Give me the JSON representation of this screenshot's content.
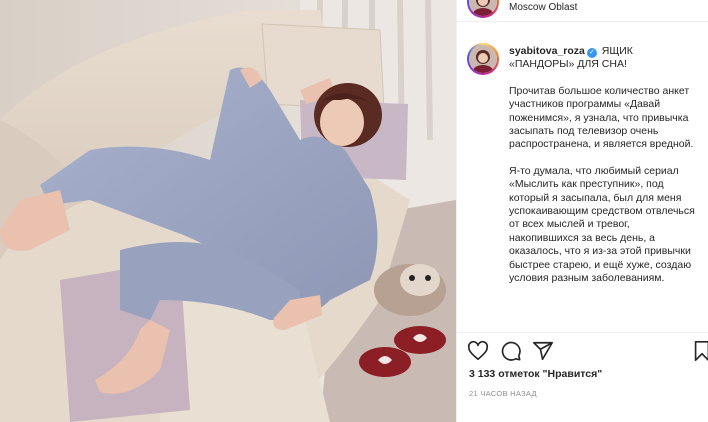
{
  "post": {
    "location": "Moscow Oblast",
    "username": "syabitova_roza",
    "verified_symbol": "✓",
    "caption_title": "ЯЩИК «ПАНДОРЫ» ДЛЯ СНА!",
    "paragraph_1": "Прочитав большое количество анкет участников программы «Давай поженимся», я узнала, что привычка засыпать под телевизор очень распространена, и является вредной.",
    "paragraph_2": "Я-то думала, что любимый сериал «Мыслить как преступник», под который я засыпала, был для меня успокаивающим средством отвлечься от всех мыслей и тревог, накопившихся за весь день, а оказалось, что я из-за этой привычки быстрее старею, и ещё хуже, создаю условия разным заболеваниям.",
    "likes_text": "3 133 отметок \"Нравится\"",
    "time_text": "21 ЧАСОВ НАЗАД"
  },
  "icons": {
    "like": "heart-outline",
    "comment": "speech-bubble-outline",
    "share": "paper-plane-outline",
    "save": "bookmark-outline"
  },
  "colors": {
    "verified": "#3897f0",
    "text": "#262626",
    "muted": "#8e8e8e",
    "pajama": "#9fa9c6",
    "sofa": "#e2d6c8"
  }
}
